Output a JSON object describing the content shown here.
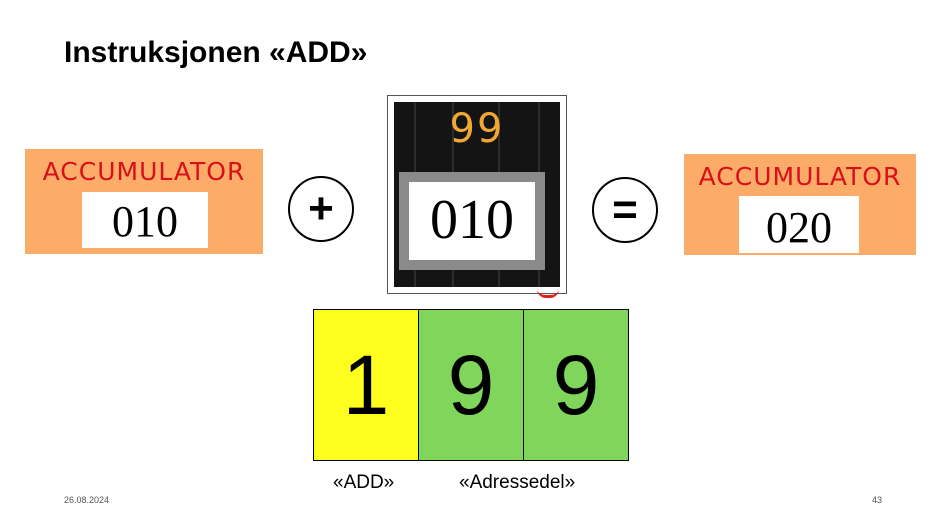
{
  "slide": {
    "title": "Instruksjonen «ADD»",
    "date": "26.08.2024",
    "page_number": "43"
  },
  "accumulator_before": {
    "label": "ACCUMULATOR",
    "value": "010"
  },
  "operator_plus": "+",
  "memory_cell": {
    "address": "99",
    "value": "010"
  },
  "operator_equals": "=",
  "accumulator_after": {
    "label": "ACCUMULATOR",
    "value": "020"
  },
  "instruction": {
    "digits": [
      "1",
      "9",
      "9"
    ],
    "opcode_caption": "«ADD»",
    "address_caption": "«Adressedel»"
  },
  "colors": {
    "accumulator_bg": "#fcac68",
    "accumulator_label": "#d7101a",
    "opcode_cell": "#ffff1f",
    "address_cell": "#7fd65a",
    "memory_address": "#f0a830"
  }
}
